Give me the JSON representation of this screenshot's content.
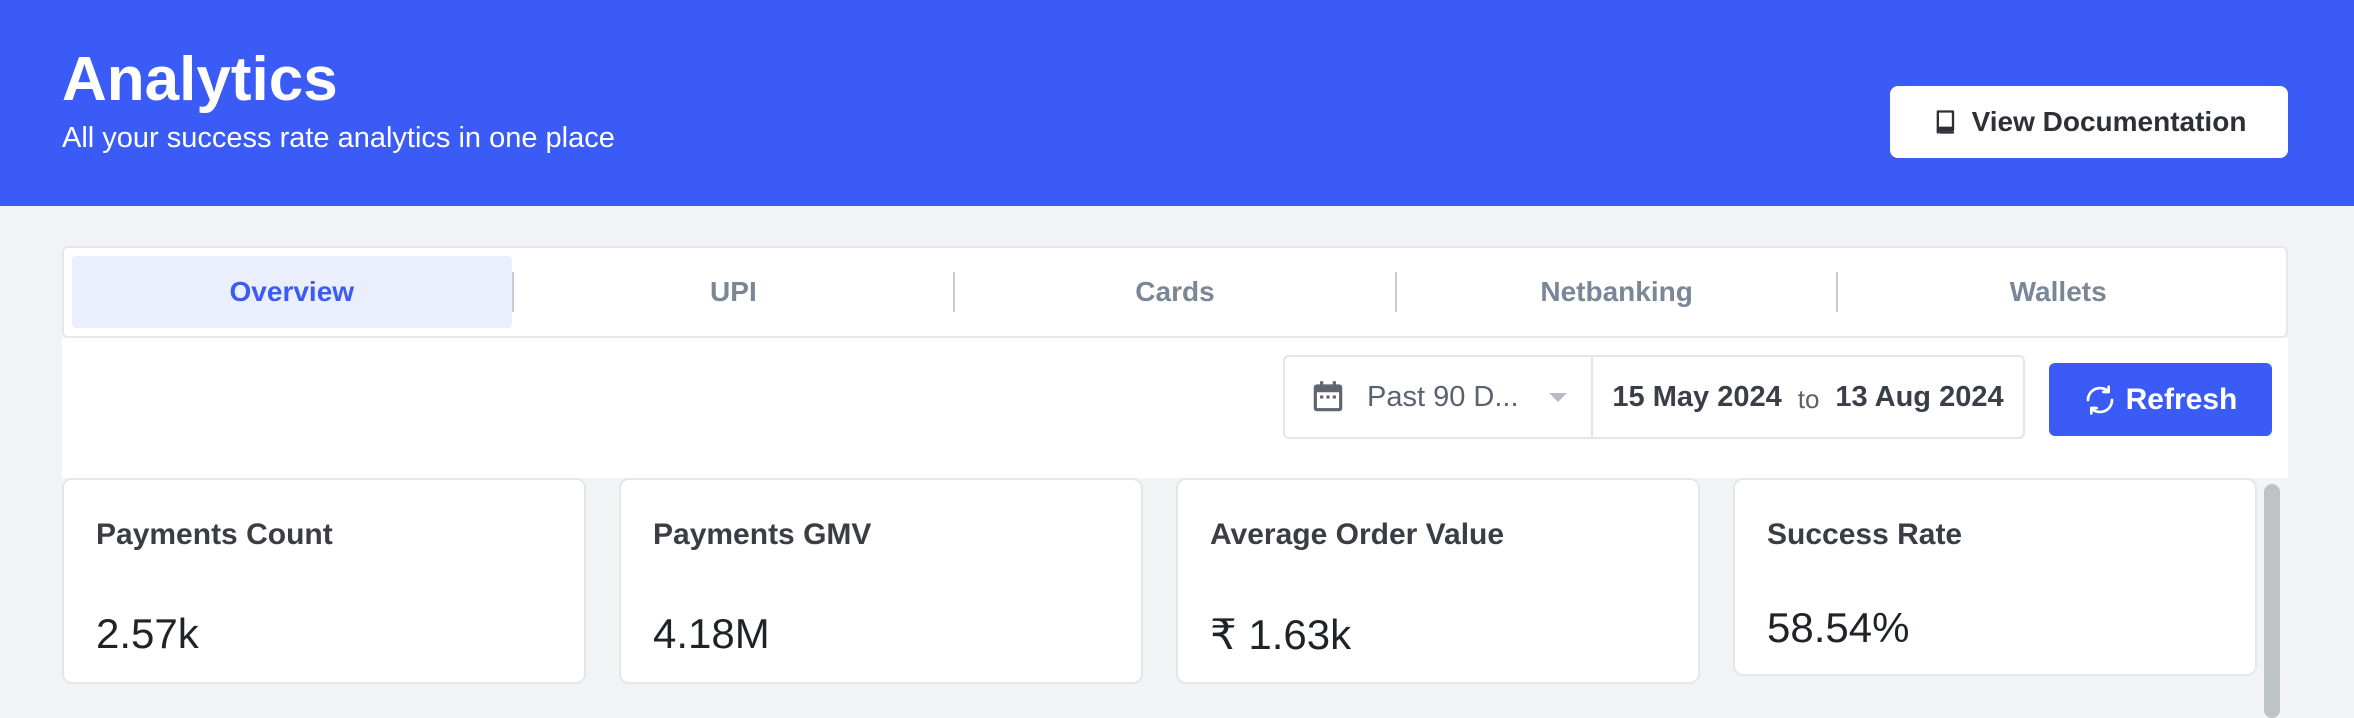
{
  "header": {
    "title": "Analytics",
    "subtitle": "All your success rate analytics in one place",
    "doc_button_label": "View Documentation"
  },
  "tabs": [
    {
      "label": "Overview",
      "active": true
    },
    {
      "label": "UPI",
      "active": false
    },
    {
      "label": "Cards",
      "active": false
    },
    {
      "label": "Netbanking",
      "active": false
    },
    {
      "label": "Wallets",
      "active": false
    }
  ],
  "filter": {
    "range_label": "Past 90 D...",
    "start_date": "15 May 2024",
    "to_label": "to",
    "end_date": "13 Aug 2024",
    "refresh_label": "Refresh"
  },
  "cards": [
    {
      "title": "Payments Count",
      "value": "2.57k"
    },
    {
      "title": "Payments GMV",
      "value": "4.18M"
    },
    {
      "title": "Average Order Value",
      "value": "₹ 1.63k"
    },
    {
      "title": "Success Rate",
      "value": "58.54%"
    }
  ],
  "colors": {
    "brand": "#3b5bf6",
    "active_tab_bg": "#eaeefd"
  }
}
